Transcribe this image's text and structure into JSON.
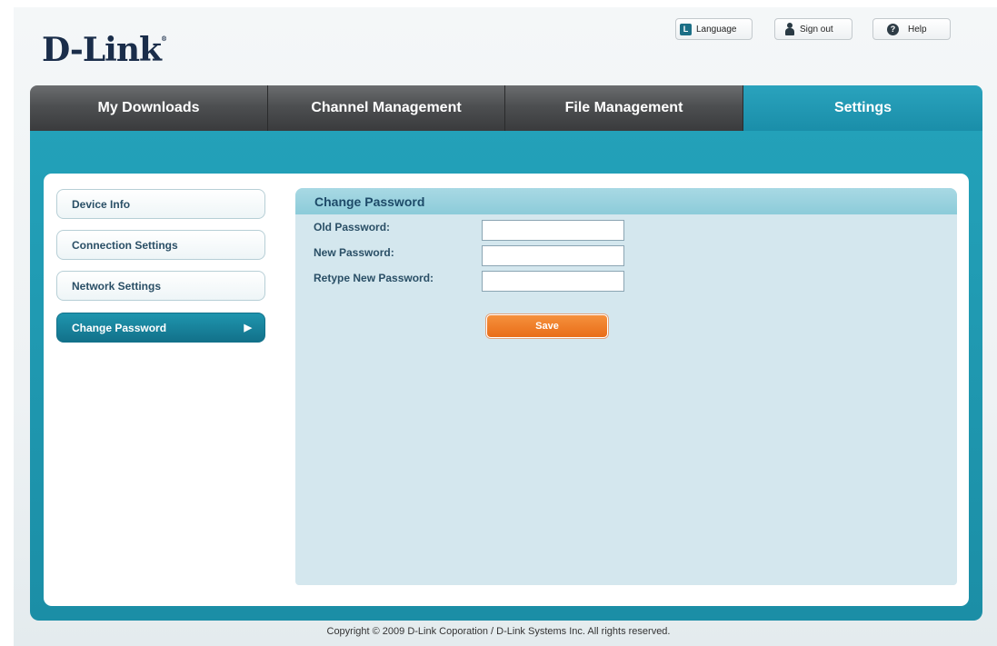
{
  "header": {
    "logo": "D-Link",
    "logo_mark": "®",
    "buttons": {
      "language": "Language",
      "language_icon_letter": "L",
      "sign_out": "Sign out",
      "help": "Help",
      "help_icon_char": "?"
    }
  },
  "tabs": [
    {
      "label": "My Downloads",
      "active": false
    },
    {
      "label": "Channel Management",
      "active": false
    },
    {
      "label": "File Management",
      "active": false
    },
    {
      "label": "Settings",
      "active": true
    }
  ],
  "sidebar": {
    "items": [
      {
        "label": "Device Info",
        "active": false
      },
      {
        "label": "Connection Settings",
        "active": false
      },
      {
        "label": "Network Settings",
        "active": false
      },
      {
        "label": "Change Password",
        "active": true
      }
    ],
    "active_arrow": "▶"
  },
  "content": {
    "title": "Change Password",
    "fields": [
      {
        "label": "Old Password:",
        "value": ""
      },
      {
        "label": "New Password:",
        "value": ""
      },
      {
        "label": "Retype New Password:",
        "value": ""
      }
    ],
    "save_label": "Save"
  },
  "footer": "Copyright © 2009 D-Link Coporation / D-Link Systems Inc. All rights reserved.",
  "colors": {
    "accent": "#1b8ea6",
    "tab_dark": "#4d4f51",
    "save_orange": "#ef7d26",
    "content_bg": "#d4e7ee"
  }
}
